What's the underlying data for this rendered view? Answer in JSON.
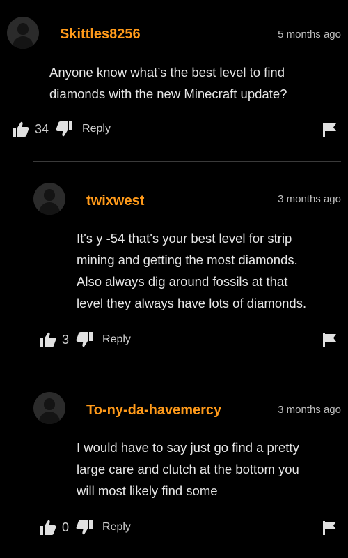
{
  "comments": [
    {
      "username": "Skittles8256",
      "time": "5 months ago",
      "lines": [
        "Anyone know what’s the best level to find",
        "diamonds with the new Minecraft update?"
      ],
      "likes": "34",
      "reply_label": "Reply"
    },
    {
      "username": "twixwest",
      "time": "3 months ago",
      "lines": [
        "It's y -54 that's your best level for strip",
        "mining and getting the most diamonds.",
        "Also always dig around fossils at that",
        "level they always have lots of diamonds."
      ],
      "likes": "3",
      "reply_label": "Reply"
    },
    {
      "username": "To-ny-da-havemercy",
      "time": "3 months ago",
      "lines": [
        "I would have to say just go find a pretty",
        "large care and clutch at the bottom you",
        "will most likely find some"
      ],
      "likes": "0",
      "reply_label": "Reply"
    }
  ],
  "icons": {
    "like": "thumbs-up-icon",
    "dislike": "thumbs-down-icon",
    "report": "flag-icon",
    "avatar": "default-avatar"
  },
  "colors": {
    "background": "#000000",
    "username": "#ff9a1a",
    "text": "#e6e6e6",
    "muted": "#bdbdbd"
  }
}
